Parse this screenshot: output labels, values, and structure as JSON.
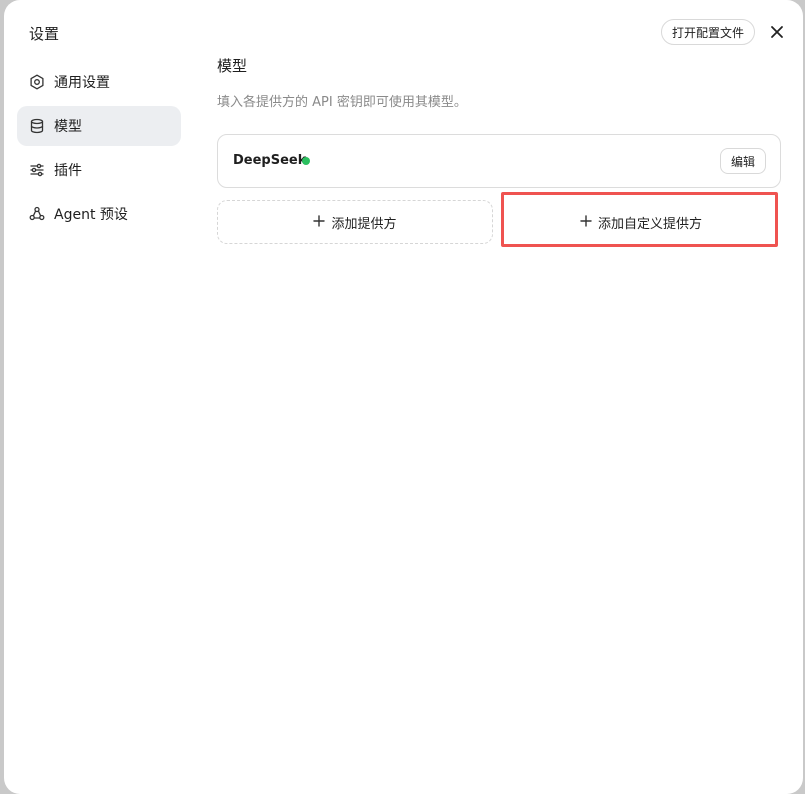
{
  "dialog": {
    "title": "设置",
    "open_config_label": "打开配置文件",
    "close_icon": "close-icon"
  },
  "sidebar": {
    "items": [
      {
        "label": "通用设置",
        "icon": "gear-icon",
        "active": false
      },
      {
        "label": "模型",
        "icon": "database-icon",
        "active": true
      },
      {
        "label": "插件",
        "icon": "sliders-icon",
        "active": false
      },
      {
        "label": "Agent 预设",
        "icon": "agent-icon",
        "active": false
      }
    ]
  },
  "main": {
    "title": "模型",
    "description": "填入各提供方的 API 密钥即可使用其模型。",
    "providers": [
      {
        "name": "DeepSeek",
        "status_color": "#2bbf5f",
        "edit_label": "编辑"
      }
    ],
    "add_provider_label": "添加提供方",
    "add_custom_provider_label": "添加自定义提供方"
  },
  "colors": {
    "highlight": "#ef5350",
    "active_bg": "#eceef1"
  }
}
